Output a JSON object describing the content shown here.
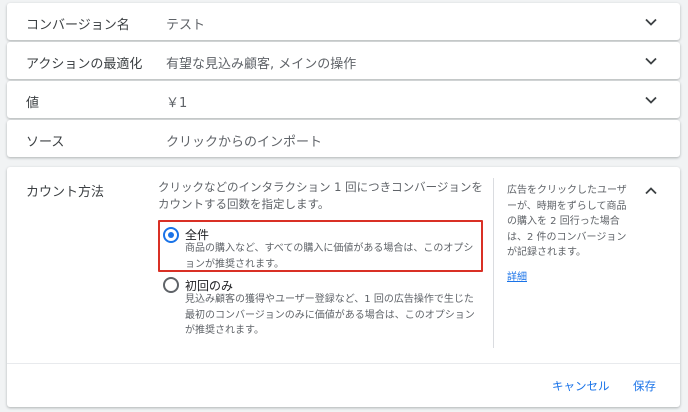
{
  "rows": [
    {
      "label": "コンバージョン名",
      "value": "テスト",
      "chevron": "chevron-down-icon"
    },
    {
      "label": "アクションの最適化",
      "value": "有望な見込み顧客, メインの操作",
      "chevron": "chevron-down-icon"
    },
    {
      "label": "値",
      "value": "￥1",
      "chevron": "chevron-down-icon"
    },
    {
      "label": "ソース",
      "value": "クリックからのインポート"
    }
  ],
  "count": {
    "title": "カウント方法",
    "description": "クリックなどのインタラクション 1 回につきコンバージョンを カウントする回数を指定します。",
    "chevron": "chevron-up-icon",
    "options": [
      {
        "title": "全件",
        "description": "商品の購入など、すべての購入に価値がある場合は、このオプションが推奨されます。",
        "selected": true
      },
      {
        "title": "初回のみ",
        "description": "見込み顧客の獲得やユーザー登録など、1 回の広告操作で生じた最初のコンバージョンのみに価値がある場合は、このオプションが推奨されます。",
        "selected": false
      }
    ],
    "help": {
      "text": "広告をクリックしたユーザーが、時期をずらして商品の購入を 2 回行った場合は、2 件のコンバージョンが記録されます。",
      "link": "詳細"
    },
    "actions": {
      "cancel": "キャンセル",
      "save": "保存"
    }
  },
  "colors": {
    "accent": "#1a73e8",
    "highlight": "#d93025",
    "background": "#f1f3f4"
  }
}
